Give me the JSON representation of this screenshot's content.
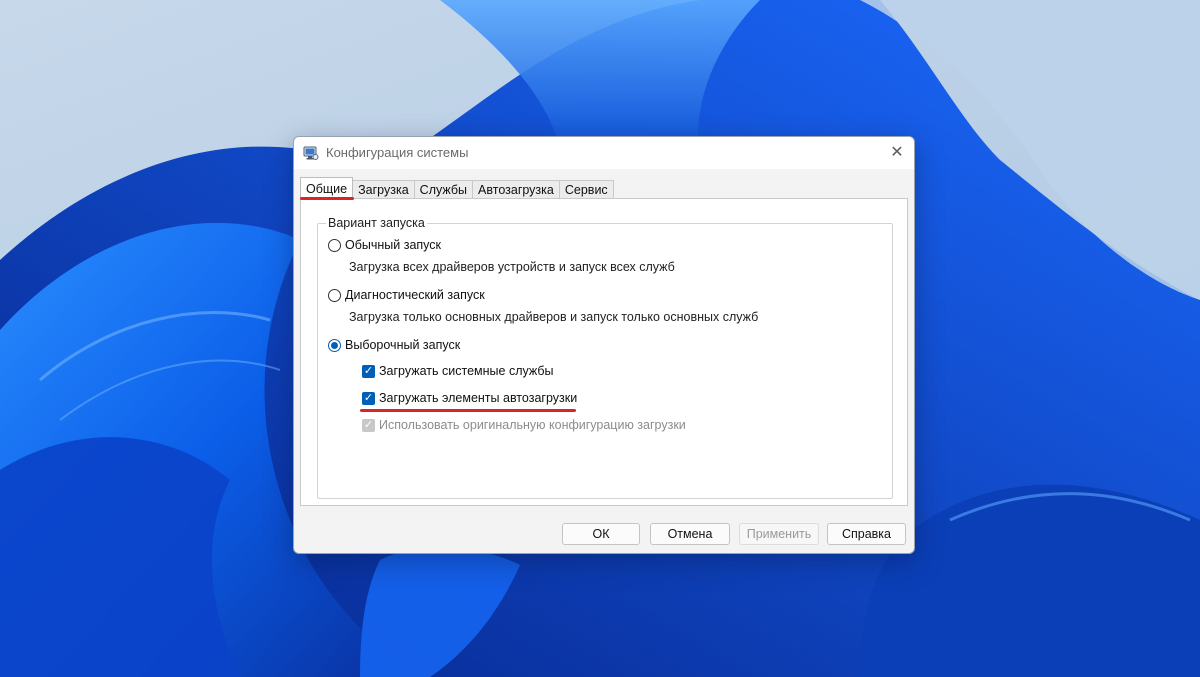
{
  "window": {
    "title": "Конфигурация системы",
    "close_glyph": "✕"
  },
  "tabs": [
    {
      "label": "Общие",
      "active": true
    },
    {
      "label": "Загрузка",
      "active": false
    },
    {
      "label": "Службы",
      "active": false
    },
    {
      "label": "Автозагрузка",
      "active": false
    },
    {
      "label": "Сервис",
      "active": false
    }
  ],
  "startup_group": {
    "legend": "Вариант запуска",
    "options": [
      {
        "label": "Обычный запуск",
        "description": "Загрузка всех драйверов устройств и запуск всех служб",
        "selected": false
      },
      {
        "label": "Диагностический запуск",
        "description": "Загрузка только основных драйверов и запуск только основных служб",
        "selected": false
      },
      {
        "label": "Выборочный запуск",
        "selected": true
      }
    ],
    "selective_checks": [
      {
        "label": "Загружать системные службы",
        "checked": true,
        "enabled": true
      },
      {
        "label": "Загружать элементы автозагрузки",
        "checked": true,
        "enabled": true
      },
      {
        "label": "Использовать оригинальную конфигурацию загрузки",
        "checked": true,
        "enabled": false
      }
    ]
  },
  "buttons": {
    "ok": "ОК",
    "cancel": "Отмена",
    "apply": "Применить",
    "help": "Справка"
  },
  "icons": {
    "app": "msconfig-computer-icon",
    "check": "✓"
  },
  "colors": {
    "accent": "#005fb8",
    "highlight_annotation": "#d8252a"
  }
}
